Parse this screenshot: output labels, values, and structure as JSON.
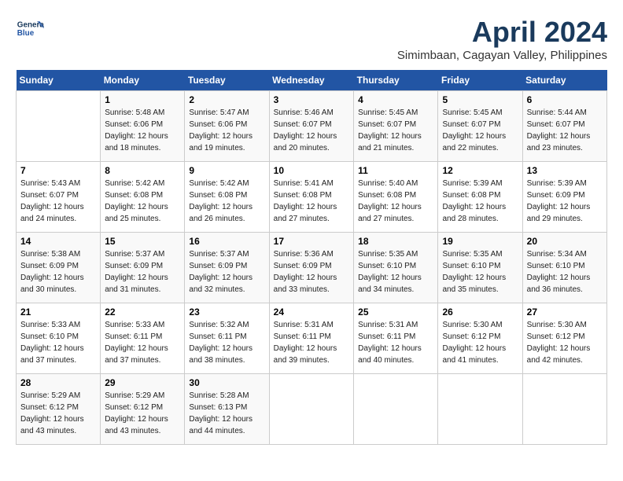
{
  "header": {
    "logo_line1": "General",
    "logo_line2": "Blue",
    "title": "April 2024",
    "subtitle": "Simimbaan, Cagayan Valley, Philippines"
  },
  "weekdays": [
    "Sunday",
    "Monday",
    "Tuesday",
    "Wednesday",
    "Thursday",
    "Friday",
    "Saturday"
  ],
  "weeks": [
    [
      {
        "day": "",
        "info": ""
      },
      {
        "day": "1",
        "info": "Sunrise: 5:48 AM\nSunset: 6:06 PM\nDaylight: 12 hours\nand 18 minutes."
      },
      {
        "day": "2",
        "info": "Sunrise: 5:47 AM\nSunset: 6:06 PM\nDaylight: 12 hours\nand 19 minutes."
      },
      {
        "day": "3",
        "info": "Sunrise: 5:46 AM\nSunset: 6:07 PM\nDaylight: 12 hours\nand 20 minutes."
      },
      {
        "day": "4",
        "info": "Sunrise: 5:45 AM\nSunset: 6:07 PM\nDaylight: 12 hours\nand 21 minutes."
      },
      {
        "day": "5",
        "info": "Sunrise: 5:45 AM\nSunset: 6:07 PM\nDaylight: 12 hours\nand 22 minutes."
      },
      {
        "day": "6",
        "info": "Sunrise: 5:44 AM\nSunset: 6:07 PM\nDaylight: 12 hours\nand 23 minutes."
      }
    ],
    [
      {
        "day": "7",
        "info": "Sunrise: 5:43 AM\nSunset: 6:07 PM\nDaylight: 12 hours\nand 24 minutes."
      },
      {
        "day": "8",
        "info": "Sunrise: 5:42 AM\nSunset: 6:08 PM\nDaylight: 12 hours\nand 25 minutes."
      },
      {
        "day": "9",
        "info": "Sunrise: 5:42 AM\nSunset: 6:08 PM\nDaylight: 12 hours\nand 26 minutes."
      },
      {
        "day": "10",
        "info": "Sunrise: 5:41 AM\nSunset: 6:08 PM\nDaylight: 12 hours\nand 27 minutes."
      },
      {
        "day": "11",
        "info": "Sunrise: 5:40 AM\nSunset: 6:08 PM\nDaylight: 12 hours\nand 27 minutes."
      },
      {
        "day": "12",
        "info": "Sunrise: 5:39 AM\nSunset: 6:08 PM\nDaylight: 12 hours\nand 28 minutes."
      },
      {
        "day": "13",
        "info": "Sunrise: 5:39 AM\nSunset: 6:09 PM\nDaylight: 12 hours\nand 29 minutes."
      }
    ],
    [
      {
        "day": "14",
        "info": "Sunrise: 5:38 AM\nSunset: 6:09 PM\nDaylight: 12 hours\nand 30 minutes."
      },
      {
        "day": "15",
        "info": "Sunrise: 5:37 AM\nSunset: 6:09 PM\nDaylight: 12 hours\nand 31 minutes."
      },
      {
        "day": "16",
        "info": "Sunrise: 5:37 AM\nSunset: 6:09 PM\nDaylight: 12 hours\nand 32 minutes."
      },
      {
        "day": "17",
        "info": "Sunrise: 5:36 AM\nSunset: 6:09 PM\nDaylight: 12 hours\nand 33 minutes."
      },
      {
        "day": "18",
        "info": "Sunrise: 5:35 AM\nSunset: 6:10 PM\nDaylight: 12 hours\nand 34 minutes."
      },
      {
        "day": "19",
        "info": "Sunrise: 5:35 AM\nSunset: 6:10 PM\nDaylight: 12 hours\nand 35 minutes."
      },
      {
        "day": "20",
        "info": "Sunrise: 5:34 AM\nSunset: 6:10 PM\nDaylight: 12 hours\nand 36 minutes."
      }
    ],
    [
      {
        "day": "21",
        "info": "Sunrise: 5:33 AM\nSunset: 6:10 PM\nDaylight: 12 hours\nand 37 minutes."
      },
      {
        "day": "22",
        "info": "Sunrise: 5:33 AM\nSunset: 6:11 PM\nDaylight: 12 hours\nand 37 minutes."
      },
      {
        "day": "23",
        "info": "Sunrise: 5:32 AM\nSunset: 6:11 PM\nDaylight: 12 hours\nand 38 minutes."
      },
      {
        "day": "24",
        "info": "Sunrise: 5:31 AM\nSunset: 6:11 PM\nDaylight: 12 hours\nand 39 minutes."
      },
      {
        "day": "25",
        "info": "Sunrise: 5:31 AM\nSunset: 6:11 PM\nDaylight: 12 hours\nand 40 minutes."
      },
      {
        "day": "26",
        "info": "Sunrise: 5:30 AM\nSunset: 6:12 PM\nDaylight: 12 hours\nand 41 minutes."
      },
      {
        "day": "27",
        "info": "Sunrise: 5:30 AM\nSunset: 6:12 PM\nDaylight: 12 hours\nand 42 minutes."
      }
    ],
    [
      {
        "day": "28",
        "info": "Sunrise: 5:29 AM\nSunset: 6:12 PM\nDaylight: 12 hours\nand 43 minutes."
      },
      {
        "day": "29",
        "info": "Sunrise: 5:29 AM\nSunset: 6:12 PM\nDaylight: 12 hours\nand 43 minutes."
      },
      {
        "day": "30",
        "info": "Sunrise: 5:28 AM\nSunset: 6:13 PM\nDaylight: 12 hours\nand 44 minutes."
      },
      {
        "day": "",
        "info": ""
      },
      {
        "day": "",
        "info": ""
      },
      {
        "day": "",
        "info": ""
      },
      {
        "day": "",
        "info": ""
      }
    ]
  ]
}
